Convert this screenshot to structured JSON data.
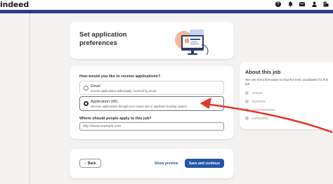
{
  "header": {
    "logo": "indeed",
    "icons": [
      "help-icon",
      "bell-icon",
      "mail-icon",
      "person-icon",
      "company-icon"
    ]
  },
  "intro": {
    "title_line1": "Set application",
    "title_line2": "preferences"
  },
  "form": {
    "question1": "How would you like to receive applications?",
    "options": [
      {
        "title": "Email",
        "description": "Screen applications individually, received by email.",
        "selected": false
      },
      {
        "title": "Application URL",
        "description": "Receive applications through your career site or applicant tracking system.",
        "selected": true
      }
    ],
    "question2": "Where should people apply to this job?",
    "url_placeholder": "http://www.example.com"
  },
  "footer": {
    "back_label": "Back",
    "preview_label": "Show preview",
    "save_label": "Save and continue"
  },
  "sidebar": {
    "title": "About this job",
    "description": "We use this information to find the best candidates for this job."
  },
  "colors": {
    "accent": "#2557a7",
    "navbar": "#2b3a8c",
    "annotation_arrow": "#e2362b"
  }
}
